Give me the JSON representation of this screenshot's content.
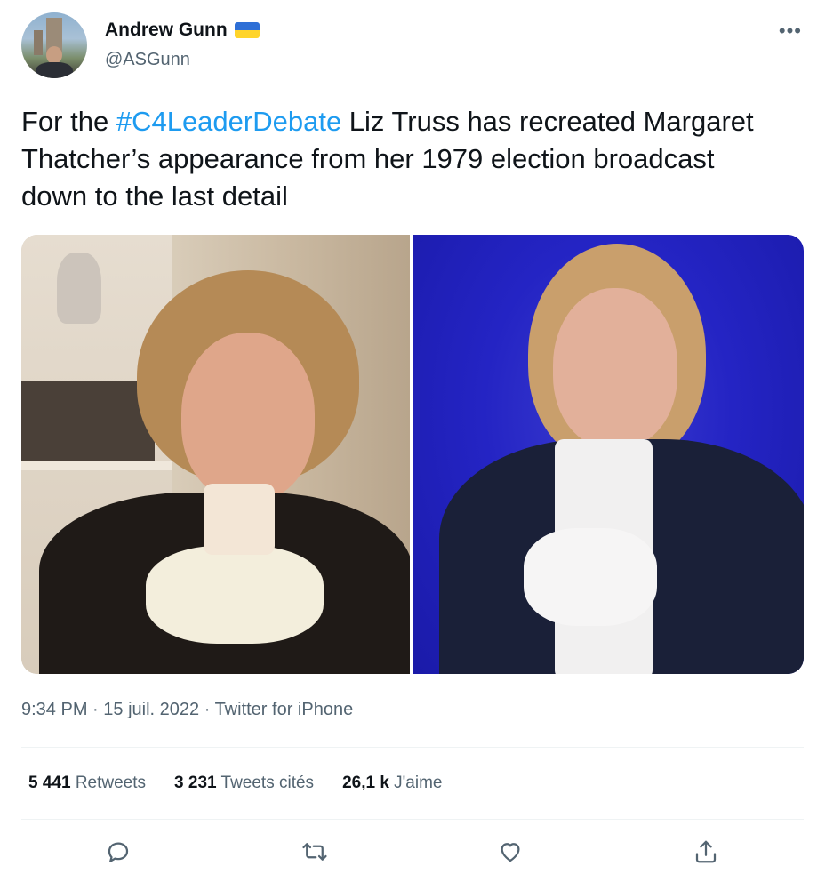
{
  "author": {
    "display_name": "Andrew Gunn",
    "handle": "@ASGunn",
    "flag_icon": "ukraine-flag-icon"
  },
  "tweet": {
    "text_before": "For the ",
    "hashtag": "#C4LeaderDebate",
    "text_after": " Liz Truss has recreated Margaret Thatcher’s appearance from her 1979 election broadcast down to the last detail"
  },
  "meta": {
    "time": "9:34 PM",
    "sep1": " · ",
    "date": "15 juil. 2022",
    "sep2": " · ",
    "source": "Twitter for iPhone"
  },
  "stats": [
    {
      "number": "5 441",
      "label": "Retweets"
    },
    {
      "number": "3 231",
      "label": "Tweets cités"
    },
    {
      "number": "26,1 k",
      "label": "J'aime"
    }
  ],
  "actions": [
    "reply-icon",
    "retweet-icon",
    "like-icon",
    "share-icon"
  ],
  "colors": {
    "accent": "#1d9bf0",
    "secondary_text": "#536471",
    "primary_text": "#0f1419"
  }
}
